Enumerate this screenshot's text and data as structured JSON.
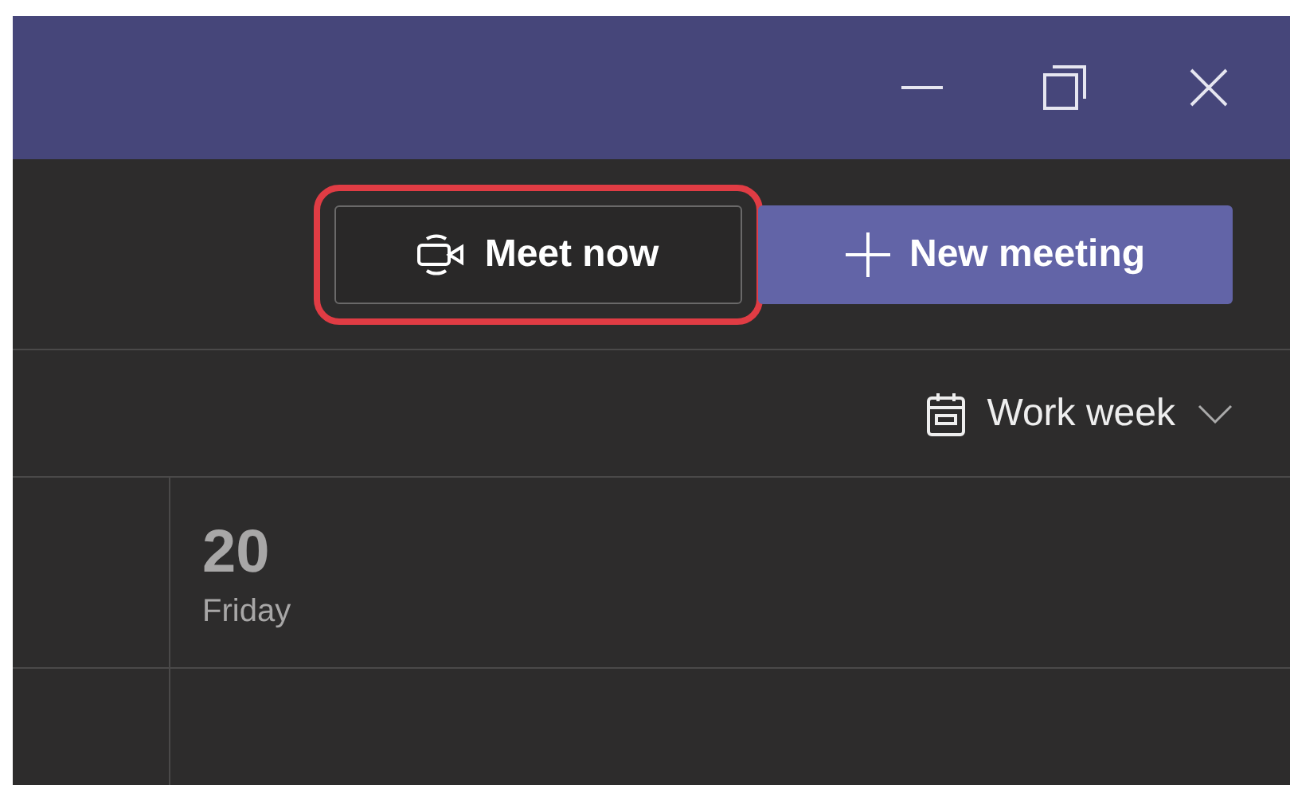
{
  "title_bar": {
    "buttons": [
      {
        "kind": "minimize"
      },
      {
        "kind": "maximize"
      },
      {
        "kind": "close"
      }
    ]
  },
  "toolbar": {
    "buttons": [
      {
        "label": "Meet now",
        "kind": "meet",
        "highlighted": true
      },
      {
        "label": "New meeting",
        "kind": "new",
        "highlighted": false
      }
    ]
  },
  "view_selector": {
    "label": "Work week"
  },
  "day": {
    "number": "20",
    "weekday": "Friday"
  }
}
